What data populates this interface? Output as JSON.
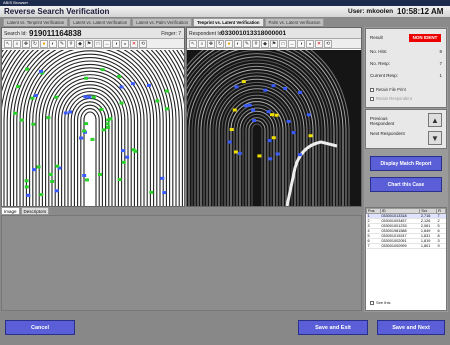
{
  "window": {
    "title": "ABIS Browser"
  },
  "header": {
    "title": "Reverse Search Verification",
    "user": "User: mkoolen",
    "time": "10:58:12 AM"
  },
  "tabs": [
    {
      "label": "Latent vs. Tenprint Verification"
    },
    {
      "label": "Latent vs. Latent Verification"
    },
    {
      "label": "Latent vs. Palm Verification"
    },
    {
      "label": "Tenprint vs. Latent Verification"
    },
    {
      "label": "Palm vs. Latent Verification"
    }
  ],
  "search": {
    "label": "Search Id:",
    "id": "919011164838",
    "finger": "Finger: 7"
  },
  "respondent": {
    "label": "Respondent Id:",
    "id": "033001013318000001"
  },
  "toolbar_icons": [
    "pointer-icon",
    "zoom-icon",
    "pan-icon",
    "rotate-icon",
    "color-icon",
    "adjust-icon",
    "mark-icon",
    "grid-icon",
    "minutiae-icon",
    "flag-icon",
    "fit-icon",
    "measure-icon",
    "contrast-icon",
    "invert-icon",
    "delete-icon",
    "reset-icon"
  ],
  "bottom_tabs": [
    "Image",
    "Descriptors"
  ],
  "side": {
    "result_label": "Result",
    "result_value": "NON IDENT",
    "hits_label": "No. Hits:",
    "hits_value": "8",
    "resp_label": "No. Resp:",
    "resp_value": "7",
    "current_label": "Current Resp:",
    "current_value": "1",
    "retain_label": "Retain File Print",
    "other_label": "Retain Respondent",
    "prev_label": "Previous Respondent",
    "next_label": "Next Respondent",
    "display_btn": "Display Match Report",
    "chart_btn": "Chart this Case"
  },
  "table": {
    "headers": [
      "Pos",
      "ID",
      "Scr",
      "Fi"
    ],
    "rows": [
      [
        "1",
        "033001013318",
        "2,716",
        "7"
      ],
      [
        "2",
        "033001003457",
        "2,126",
        "2"
      ],
      [
        "3",
        "033001001233",
        "2,061",
        "5"
      ],
      [
        "4",
        "033001981588",
        "1,849",
        "6"
      ],
      [
        "5",
        "033001019247",
        "1,831",
        "8"
      ],
      [
        "6",
        "033001002051",
        "1,819",
        "3"
      ],
      [
        "7",
        "033001000999",
        "1,801",
        "9"
      ]
    ],
    "seeview": "See this"
  },
  "footer": {
    "cancel": "Cancel",
    "save_exit": "Save and Exit",
    "save_next": "Save and Next"
  },
  "colors": {
    "accent": "#5a5fd8",
    "reject": "#e00000",
    "title_bg": "#1c2a4e"
  }
}
